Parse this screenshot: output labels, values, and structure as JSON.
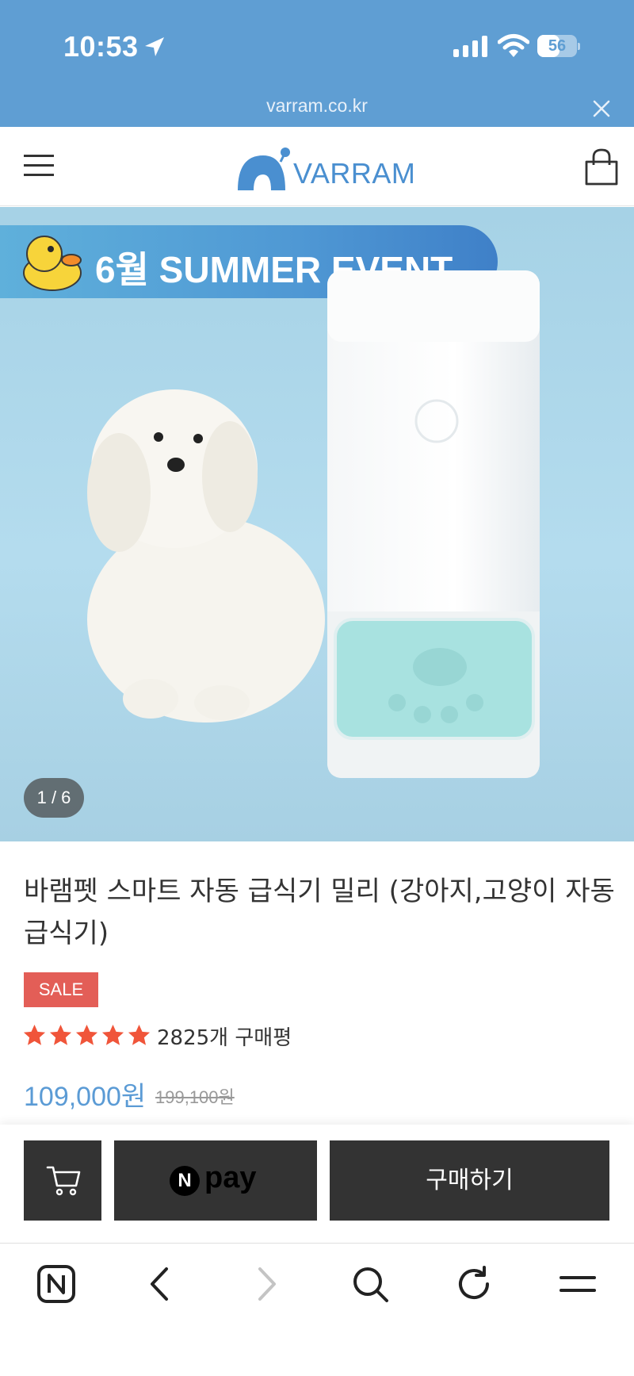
{
  "status_bar": {
    "time": "10:53",
    "battery": "56",
    "battery_level": 0.56,
    "icons": [
      "location-arrow-icon",
      "cellular-signal-icon",
      "wifi-icon",
      "battery-icon"
    ]
  },
  "browser": {
    "url": "varram.co.kr",
    "toolbar_icons": [
      "naver-home-icon",
      "back-icon",
      "forward-icon",
      "search-icon",
      "reload-icon",
      "menu-icon"
    ]
  },
  "header": {
    "logo_text": "VARRAM",
    "icons": [
      "hamburger-menu-icon",
      "shopping-bag-icon"
    ]
  },
  "hero": {
    "event_banner": "6월 SUMMER EVENT",
    "slide_counter": "1 / 6"
  },
  "product": {
    "title": "바램펫 스마트 자동 급식기 밀리 (강아지,고양이 자동급식기)",
    "sale_badge": "SALE",
    "rating_stars": 5,
    "review_count": "2825개 구매평",
    "price": "109,000원",
    "original_price": "199,100원"
  },
  "buy_bar": {
    "npay_n": "N",
    "npay_label": "pay",
    "buy_label": "구매하기"
  },
  "colors": {
    "status_bar_bg": "#5f9ed3",
    "logo_blue": "#4a8fd0",
    "price_blue": "#5b9bd5",
    "sale_red": "#e35e57",
    "star_orange": "#f0553a",
    "dark_button": "#333333"
  }
}
